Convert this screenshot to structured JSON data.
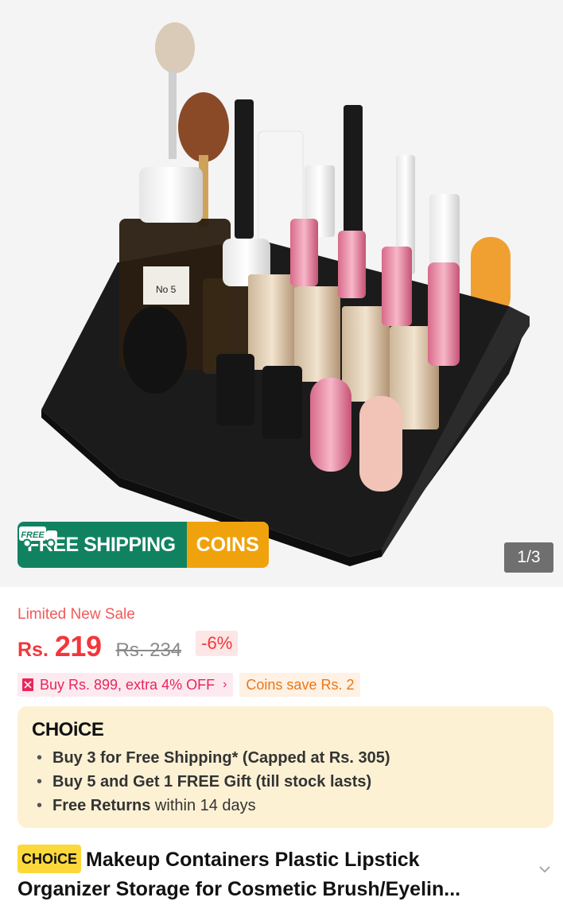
{
  "gallery": {
    "banner": {
      "free_badge": "FREE",
      "shipping_label": "FREE SHIPPING",
      "coins_label": "COINS"
    },
    "counter": "1/3",
    "perfume_label": "No 5",
    "icons": [
      "truck-icon"
    ]
  },
  "pricing": {
    "sale_label": "Limited New Sale",
    "currency": "Rs.",
    "price": "219",
    "original_price": "Rs. 234",
    "discount": "-6%"
  },
  "promos": {
    "bundle_offer": "Buy Rs. 899, extra 4% OFF",
    "coins_save": "Coins save Rs. 2"
  },
  "choice": {
    "logo": "CHOiCE",
    "items": [
      {
        "bold": "Buy 3 for  Free Shipping* (Capped at Rs. 305)",
        "rest": ""
      },
      {
        "bold": "Buy 5 and Get 1 FREE Gift (till stock lasts)",
        "rest": ""
      },
      {
        "bold": "Free Returns",
        "rest": " within 14 days"
      }
    ]
  },
  "product": {
    "choice_chip": "CHOiCE",
    "title_line1": "Makeup Containers Plastic Lipstick",
    "title_line2": "Organizer Storage for Cosmetic Brush/Eyelin..."
  },
  "colors": {
    "price_red": "#f3363a",
    "shipping_green": "#11825f",
    "coins_orange": "#f0a20c",
    "choice_bg": "#fdf1d4",
    "choice_chip": "#fcd83a"
  }
}
